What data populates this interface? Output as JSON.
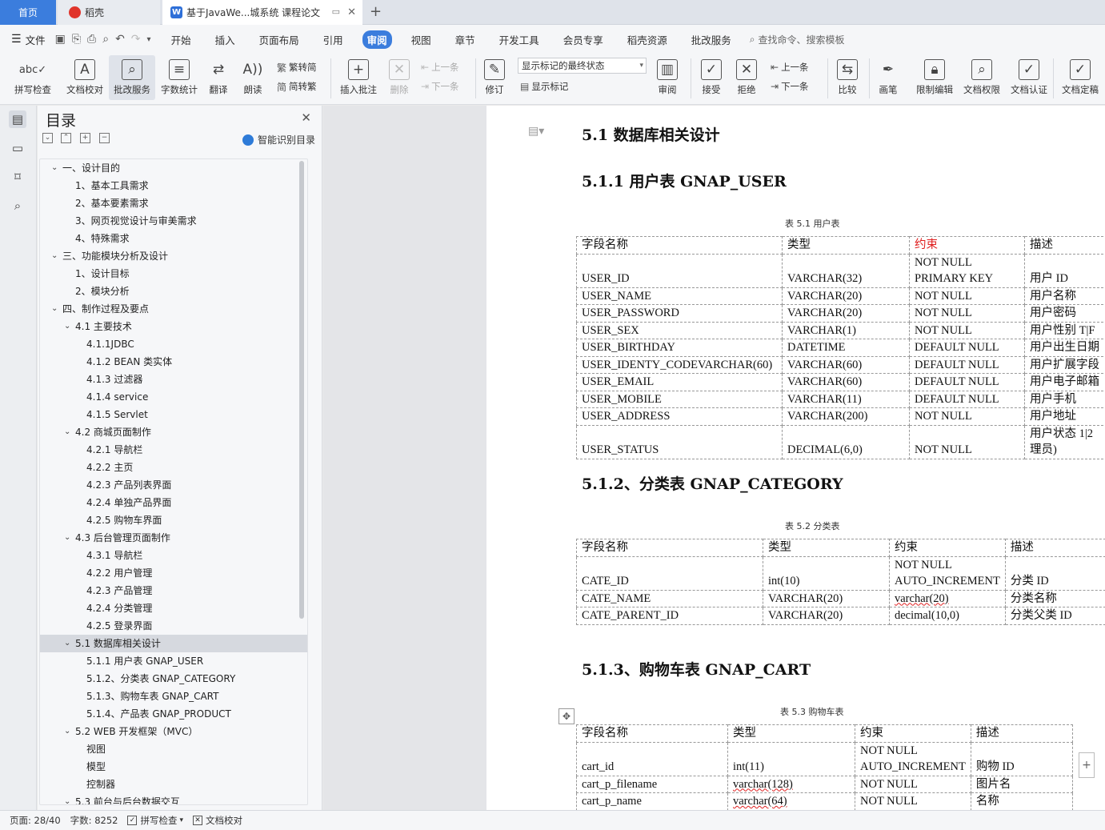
{
  "tabs": {
    "home": "首页",
    "daoke": "稻壳",
    "doc": "基于JavaWe...城系统 课程论文"
  },
  "menu": {
    "file": "文件",
    "items": [
      "开始",
      "插入",
      "页面布局",
      "引用",
      "审阅",
      "视图",
      "章节",
      "开发工具",
      "会员专享",
      "稻壳资源",
      "批改服务"
    ],
    "active": "审阅",
    "search_placeholder": "查找命令、搜索模板"
  },
  "ribbon": {
    "spell": "拼写检查",
    "doc_check": "文档校对",
    "review_service": "批改服务",
    "word_count": "字数统计",
    "translate": "翻译",
    "read_aloud": "朗读",
    "trad_to_simp": "繁转简",
    "simp_to_trad": "简转繁",
    "insert_comment": "插入批注",
    "delete": "删除",
    "prev": "上一条",
    "next": "下一条",
    "track_changes": "修订",
    "markup_state": "显示标记的最终状态",
    "show_markup": "显示标记",
    "review": "审阅",
    "accept": "接受",
    "reject": "拒绝",
    "prev2": "上一条",
    "next2": "下一条",
    "compare": "比较",
    "pen": "画笔",
    "restrict_edit": "限制编辑",
    "doc_permission": "文档权限",
    "doc_cert": "文档认证",
    "doc_finalize": "文档定稿"
  },
  "toc": {
    "title": "目录",
    "smart": "智能识别目录",
    "items": [
      {
        "label": "一、设计目的",
        "level": 0,
        "chev": "open"
      },
      {
        "label": "1、基本工具需求",
        "level": 1
      },
      {
        "label": "2、基本要素需求",
        "level": 1
      },
      {
        "label": "3、网页视觉设计与审美需求",
        "level": 1
      },
      {
        "label": "4、特殊需求",
        "level": 1
      },
      {
        "label": "三、功能模块分析及设计",
        "level": 0,
        "chev": "open"
      },
      {
        "label": "1、设计目标",
        "level": 1
      },
      {
        "label": "2、模块分析",
        "level": 1
      },
      {
        "label": "四、制作过程及要点",
        "level": 0,
        "chev": "open"
      },
      {
        "label": "4.1 主要技术",
        "level": 1,
        "chev": "open"
      },
      {
        "label": "4.1.1JDBC",
        "level": 2
      },
      {
        "label": "4.1.2 BEAN 类实体",
        "level": 2
      },
      {
        "label": "4.1.3 过滤器",
        "level": 2
      },
      {
        "label": "4.1.4 service",
        "level": 2
      },
      {
        "label": "4.1.5 Servlet",
        "level": 2
      },
      {
        "label": "4.2 商城页面制作",
        "level": 1,
        "chev": "open"
      },
      {
        "label": "4.2.1 导航栏",
        "level": 2
      },
      {
        "label": "4.2.2 主页",
        "level": 2
      },
      {
        "label": "4.2.3 产品列表界面",
        "level": 2
      },
      {
        "label": "4.2.4 单独产品界面",
        "level": 2
      },
      {
        "label": "4.2.5 购物车界面",
        "level": 2
      },
      {
        "label": "4.3 后台管理页面制作",
        "level": 1,
        "chev": "open"
      },
      {
        "label": "4.3.1 导航栏",
        "level": 2
      },
      {
        "label": "4.2.2 用户管理",
        "level": 2
      },
      {
        "label": "4.2.3 产品管理",
        "level": 2
      },
      {
        "label": "4.2.4 分类管理",
        "level": 2
      },
      {
        "label": "4.2.5 登录界面",
        "level": 2
      },
      {
        "label": "5.1 数据库相关设计",
        "level": 1,
        "chev": "open",
        "selected": true
      },
      {
        "label": "5.1.1 用户表 GNAP_USER",
        "level": 2
      },
      {
        "label": "5.1.2、分类表 GNAP_CATEGORY",
        "level": 2
      },
      {
        "label": "5.1.3、购物车表 GNAP_CART",
        "level": 2
      },
      {
        "label": "5.1.4、产品表 GNAP_PRODUCT",
        "level": 2
      },
      {
        "label": "5.2 WEB 开发框架（MVC）",
        "level": 1,
        "chev": "open"
      },
      {
        "label": "视图",
        "level": 2
      },
      {
        "label": "模型",
        "level": 2
      },
      {
        "label": "控制器",
        "level": 2
      },
      {
        "label": "5.3 前台与后台数据交互",
        "level": 1,
        "chev": "open"
      }
    ]
  },
  "doc": {
    "h1": "5.1 数据库相关设计",
    "h_user": "5.1.1 用户表 GNAP_USER",
    "cap_user": "表 5.1  用户表",
    "h_cat": "5.1.2、分类表 GNAP_CATEGORY",
    "cap_cat": "表 5.2  分类表",
    "h_cart": "5.1.3、购物车表 GNAP_CART",
    "cap_cart": "表 5.3  购物车表",
    "user_table": {
      "header": [
        "字段名称",
        "类型",
        "约束",
        "描述"
      ],
      "rows": [
        {
          "field": "USER_ID",
          "type": "VARCHAR(32)",
          "constraint_top": "NOT NULL",
          "constraint": "PRIMARY KEY",
          "desc": "用户 ID"
        },
        {
          "field": "USER_NAME",
          "type": "VARCHAR(20)",
          "constraint": "NOT NULL",
          "desc": "用户名称"
        },
        {
          "field": "USER_PASSWORD",
          "type": "VARCHAR(20)",
          "constraint": "NOT NULL",
          "desc": "用户密码"
        },
        {
          "field": "USER_SEX",
          "type": "VARCHAR(1)",
          "constraint": "NOT NULL",
          "desc": "用户性别 T|F"
        },
        {
          "field": "USER_BIRTHDAY",
          "type": "DATETIME",
          "constraint": "DEFAULT NULL",
          "desc": "用户出生日期"
        },
        {
          "field": "USER_IDENTY_CODEVARCHAR(60)",
          "type": "VARCHAR(60)",
          "constraint": "DEFAULT NULL",
          "desc": "用户扩展字段"
        },
        {
          "field": "USER_EMAIL",
          "type": "VARCHAR(60)",
          "constraint": "DEFAULT NULL",
          "desc": "用户电子邮箱"
        },
        {
          "field": "USER_MOBILE",
          "type": "VARCHAR(11)",
          "constraint": "DEFAULT NULL",
          "desc": "用户手机"
        },
        {
          "field": "USER_ADDRESS",
          "type": "VARCHAR(200)",
          "constraint": "NOT NULL",
          "desc": "用户地址"
        },
        {
          "field": "USER_STATUS",
          "type": "DECIMAL(6,0)",
          "constraint": "NOT NULL",
          "desc_top": "用户状态 1|2",
          "desc": "理员)"
        }
      ]
    },
    "cat_table": {
      "header": [
        "字段名称",
        "类型",
        "约束",
        "描述"
      ],
      "rows": [
        {
          "field": "CATE_ID",
          "type": "int(10)",
          "constraint_top": "NOT NULL",
          "constraint": "AUTO_INCREMENT",
          "desc": "分类 ID"
        },
        {
          "field": "CATE_NAME",
          "type": "VARCHAR(20)",
          "constraint": "varchar(20)",
          "desc": "分类名称"
        },
        {
          "field": "CATE_PARENT_ID",
          "type": "VARCHAR(20)",
          "constraint": "decimal(10,0)",
          "desc": "分类父类 ID"
        }
      ]
    },
    "cart_table": {
      "header": [
        "字段名称",
        "类型",
        "约束",
        "描述"
      ],
      "rows": [
        {
          "field": "cart_id",
          "type": "int(11)",
          "constraint_top": "NOT NULL",
          "constraint": "AUTO_INCREMENT",
          "desc": "购物 ID"
        },
        {
          "field": "cart_p_filename",
          "type": "varchar(128)",
          "constraint": "NOT NULL",
          "desc": "图片名"
        },
        {
          "field": "cart_p_name",
          "type": "varchar(64)",
          "constraint": "NOT NULL",
          "desc": "名称"
        }
      ]
    }
  },
  "status": {
    "page": "页面: 28/40",
    "words": "字数: 8252",
    "spell": "拼写检查",
    "doc_check": "文档校对"
  },
  "colors": {
    "accent": "#3b7ddd",
    "constraint_header": "#e02020"
  }
}
